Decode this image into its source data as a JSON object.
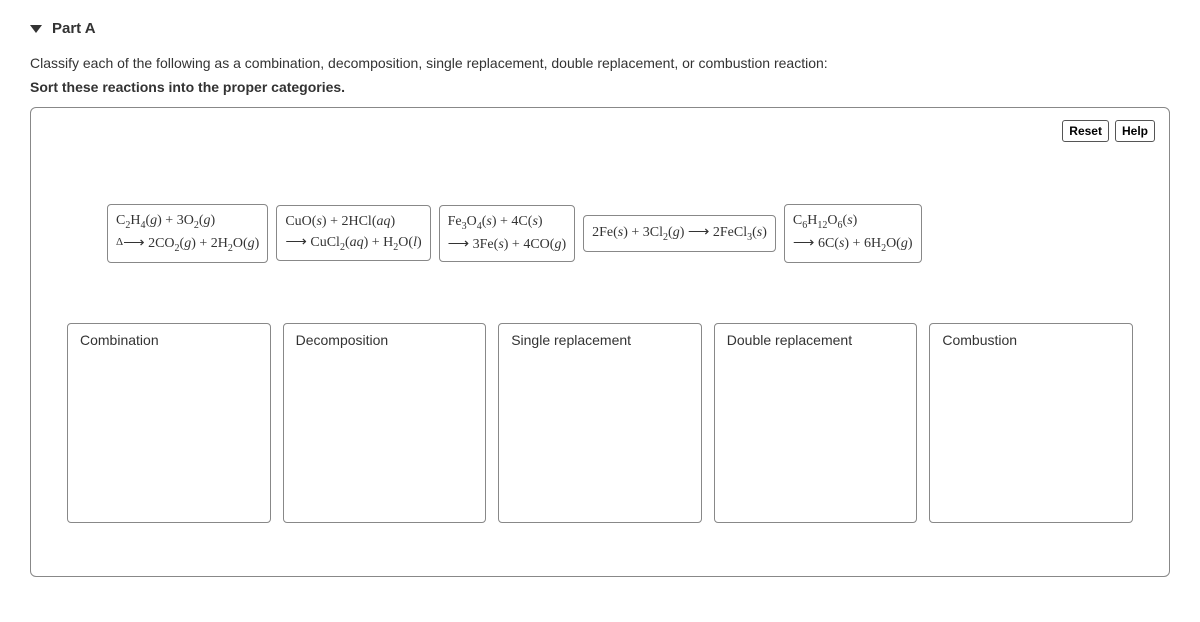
{
  "header": {
    "part_label": "Part A"
  },
  "instructions": {
    "line1": "Classify each of the following as a combination, decomposition, single replacement, double replacement, or combustion reaction:",
    "line2": "Sort these reactions into the proper categories."
  },
  "buttons": {
    "reset": "Reset",
    "help": "Help"
  },
  "reactions": [
    {
      "id": "rxn-ethylene-combustion",
      "line1_html": "C<sub>2</sub>H<sub>4</sub>(<i>g</i>) + 3O<sub>2</sub>(<i>g</i>)",
      "line2_html": "<span class='delta'>Δ</span><span class='arrow'>&#10230;</span> 2CO<sub>2</sub>(<i>g</i>) + 2H<sub>2</sub>O(<i>g</i>)"
    },
    {
      "id": "rxn-cuo-hcl",
      "line1_html": "CuO(<i>s</i>) + 2HCl(<i>aq</i>)",
      "line2_html": "<span class='arrow'>&#10230;</span> CuCl<sub>2</sub>(<i>aq</i>) + H<sub>2</sub>O(<i>l</i>)"
    },
    {
      "id": "rxn-fe3o4-c",
      "line1_html": "Fe<sub>3</sub>O<sub>4</sub>(<i>s</i>) + 4C(<i>s</i>)",
      "line2_html": "<span class='arrow'>&#10230;</span> 3Fe(<i>s</i>) + 4CO(<i>g</i>)"
    },
    {
      "id": "rxn-fe-cl2",
      "line1_html": "2Fe(<i>s</i>) + 3Cl<sub>2</sub>(<i>g</i>) <span class='arrow'>&#10230;</span> 2FeCl<sub>3</sub>(<i>s</i>)",
      "line2_html": ""
    },
    {
      "id": "rxn-glucose-decomp",
      "line1_html": "C<sub>6</sub>H<sub>12</sub>O<sub>6</sub>(<i>s</i>)",
      "line2_html": "<span class='arrow'>&#10230;</span> 6C(<i>s</i>) + 6H<sub>2</sub>O(<i>g</i>)"
    }
  ],
  "bins": [
    {
      "id": "bin-combination",
      "label": "Combination"
    },
    {
      "id": "bin-decomposition",
      "label": "Decomposition"
    },
    {
      "id": "bin-single-replacement",
      "label": "Single replacement"
    },
    {
      "id": "bin-double-replacement",
      "label": "Double replacement"
    },
    {
      "id": "bin-combustion",
      "label": "Combustion"
    }
  ]
}
